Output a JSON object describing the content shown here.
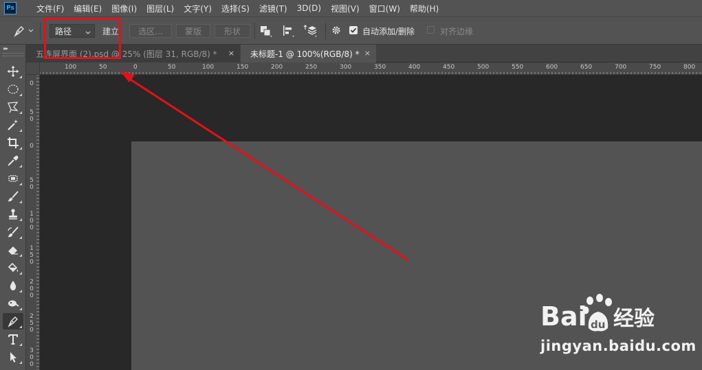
{
  "app": {
    "logo_text": "Ps"
  },
  "menu": [
    "文件(F)",
    "编辑(E)",
    "图像(I)",
    "图层(L)",
    "文字(Y)",
    "选择(S)",
    "滤镜(T)",
    "3D(D)",
    "视图(V)",
    "窗口(W)",
    "帮助(H)"
  ],
  "options_bar": {
    "tool_icon": "pen-icon",
    "mode_value": "路径",
    "make_label": "建立:",
    "selection_button": "选区...",
    "mask_button": "蒙版",
    "shape_button": "形状",
    "auto_add_delete_label": "自动添加/删除",
    "auto_add_delete_checked": true,
    "align_edges_label": "对齐边缘",
    "align_edges_checked": false
  },
  "tabs": [
    {
      "label": "五连屏界面 (2).psd @ 25% (图层 31, RGB/8) *",
      "close": "×",
      "active": false
    },
    {
      "label": "未标题-1 @ 100%(RGB/8) *",
      "close": "×",
      "active": true
    }
  ],
  "ruler_h_labels": [
    "100",
    "50",
    "0",
    "50",
    "100",
    "150",
    "200",
    "250",
    "300",
    "350",
    "400",
    "450",
    "500",
    "550",
    "600",
    "650",
    "700",
    "750",
    "800"
  ],
  "ruler_v_labels": [
    "0",
    "50",
    "0",
    "50",
    "100",
    "150",
    "200",
    "250",
    "300"
  ],
  "toolbar_tools": [
    "move-icon",
    "ellipse-marquee-icon",
    "polygon-lasso-icon",
    "magic-wand-icon",
    "crop-icon",
    "eyedropper-icon",
    "spot-healing-icon",
    "brush-icon",
    "clone-stamp-icon",
    "history-brush-icon",
    "eraser-icon",
    "paint-bucket-icon",
    "blur-drop-icon",
    "dodge-icon",
    "pen-icon",
    "type-icon",
    "path-selection-icon"
  ],
  "active_tool": "pen-icon",
  "annotation": {
    "color": "#e6101a"
  },
  "watermark": {
    "brand": "Bai du 经验",
    "url": "jingyan.baidu.com"
  },
  "colors": {
    "ps_blue": "#31a8ff",
    "panel": "#535353",
    "workspace": "#282828"
  }
}
